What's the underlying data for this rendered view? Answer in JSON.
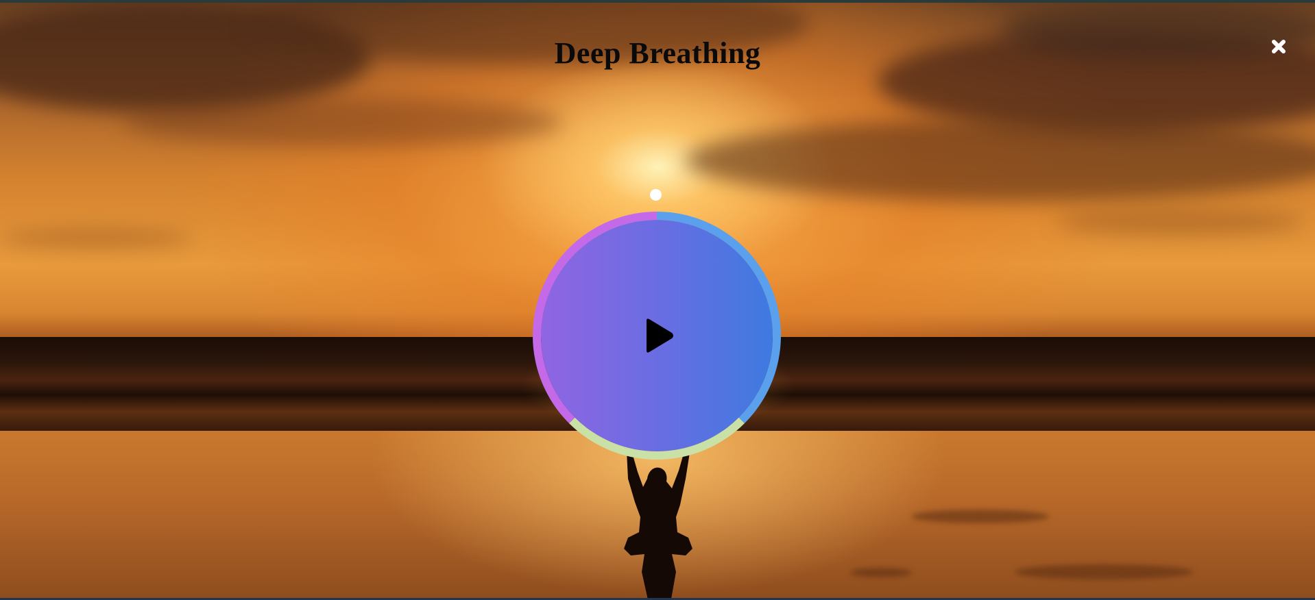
{
  "session": {
    "title": "Deep Breathing"
  },
  "controls": {
    "close_icon": "close-icon",
    "play_icon": "play-icon"
  },
  "breath_cycle": {
    "phases": [
      {
        "color": "#5aa0ec",
        "fraction": 0.375
      },
      {
        "color": "#c9e0a6",
        "fraction": 0.25
      },
      {
        "color": "#c46ae8",
        "fraction": 0.375
      }
    ],
    "position": 0
  },
  "colors": {
    "orb_left": "#9065e2",
    "orb_right": "#3e7ae0",
    "title_text": "#0a0a0a",
    "marker": "#ffffff"
  }
}
